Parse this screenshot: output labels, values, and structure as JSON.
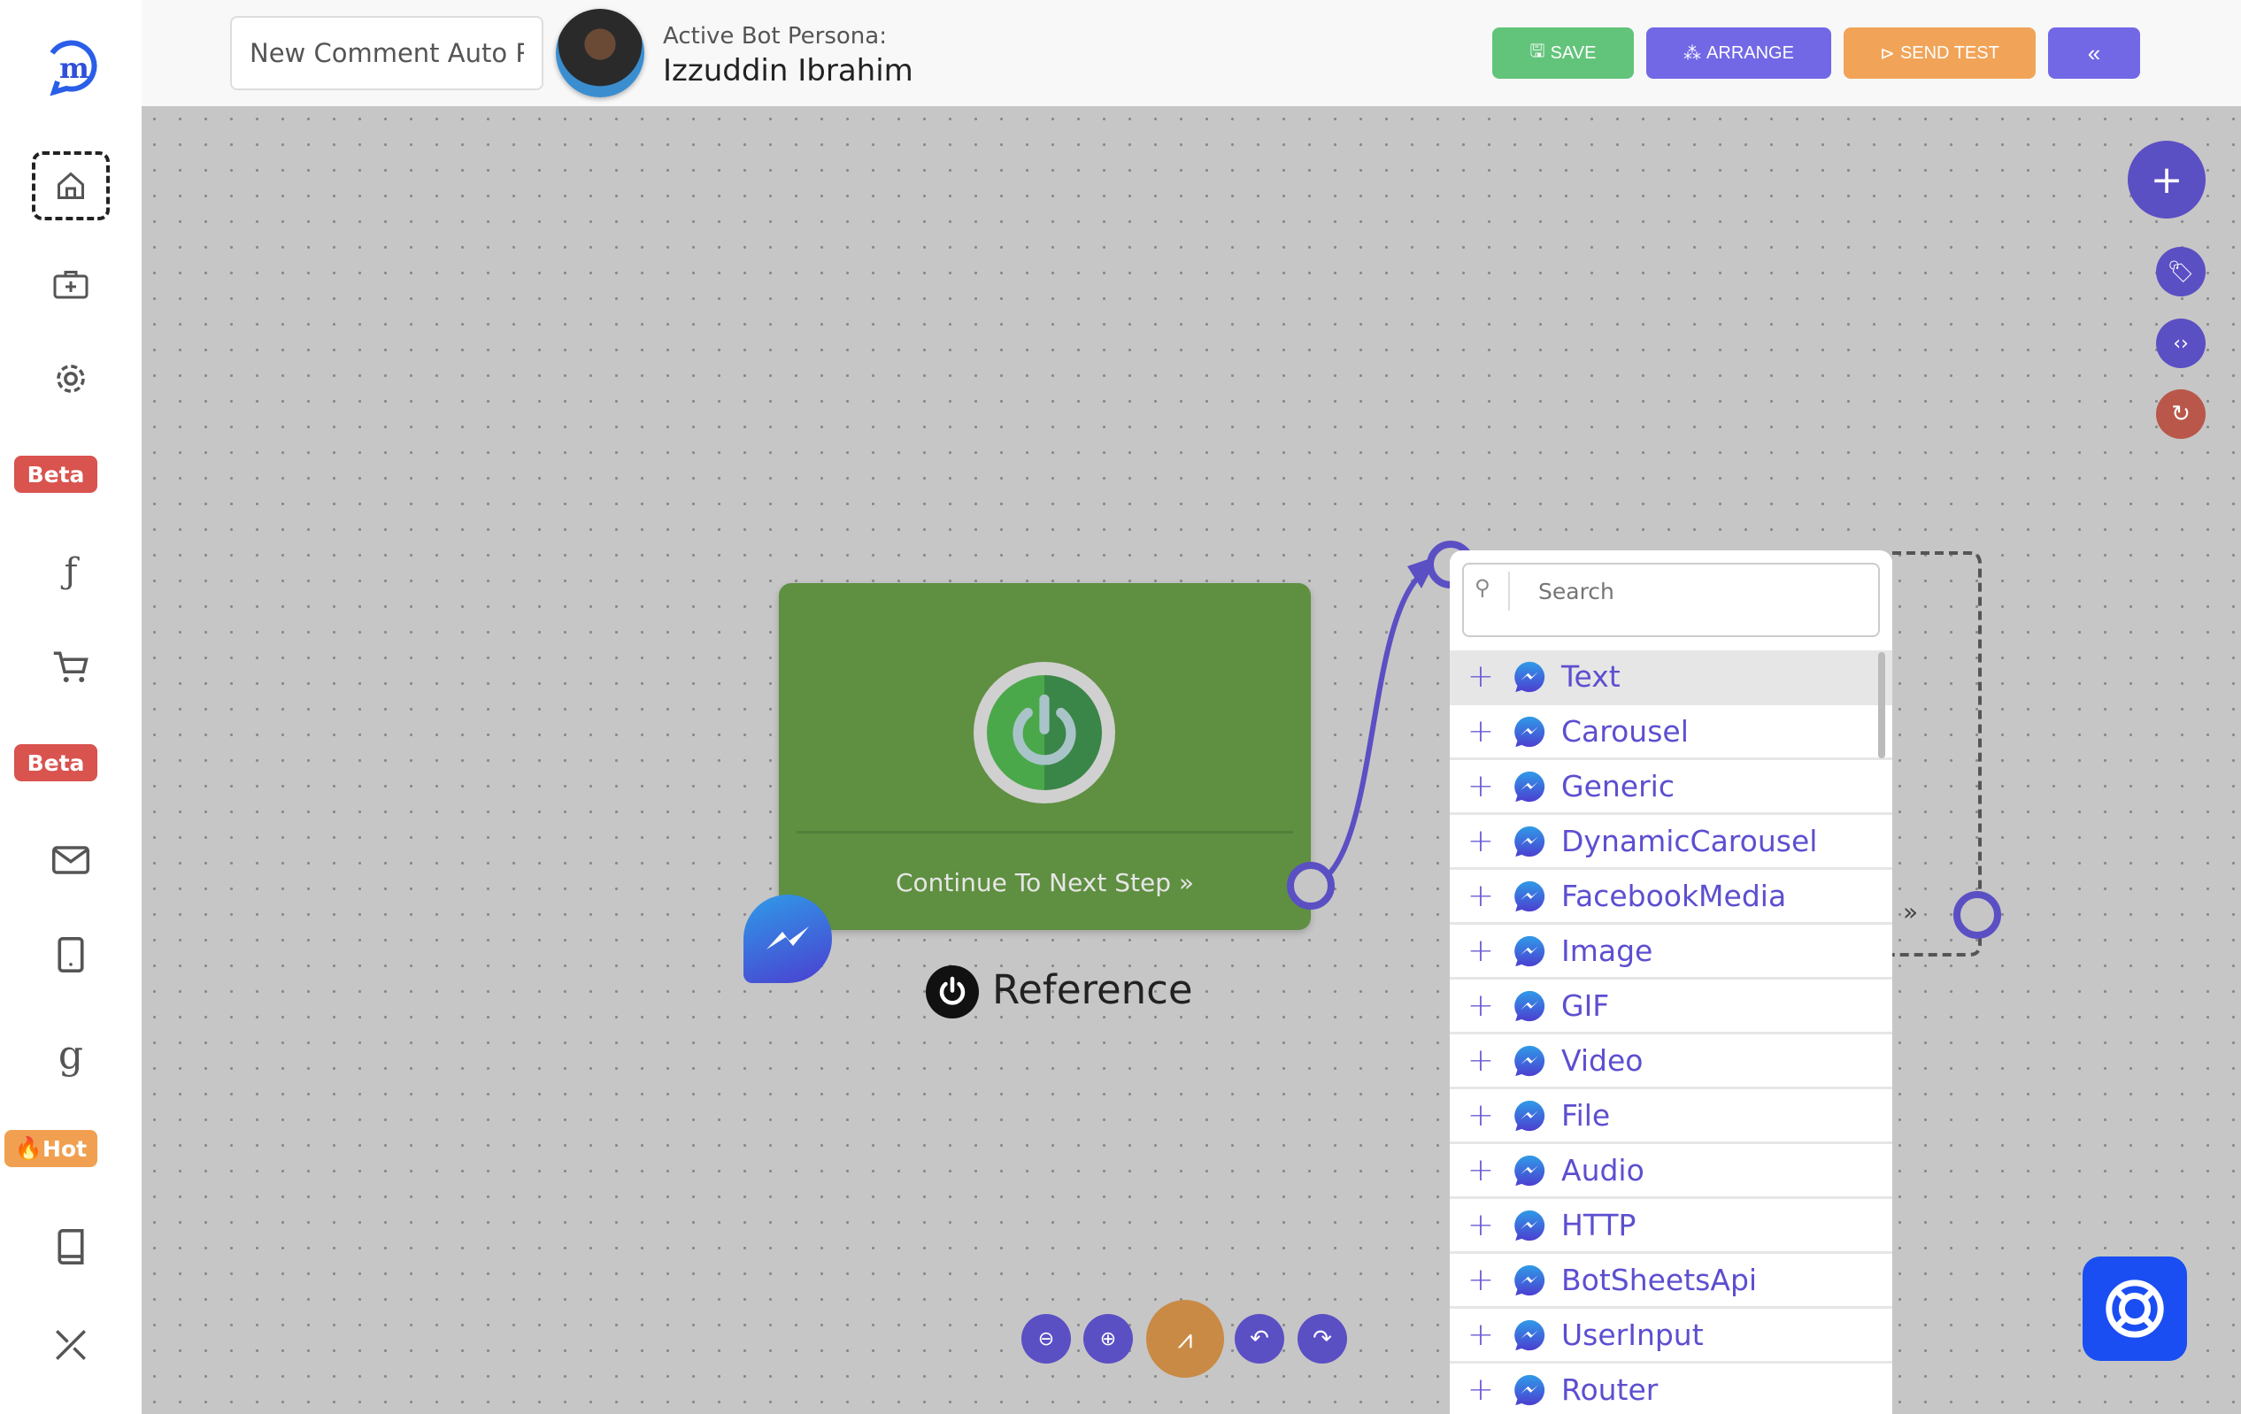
{
  "header": {
    "title_value": "New Comment Auto R",
    "persona_label": "Active Bot Persona:",
    "persona_name": "Izzuddin Ibrahim",
    "buttons": {
      "save": "SAVE",
      "arrange": "ARRANGE",
      "send_test": "SEND TEST",
      "collapse": "«"
    }
  },
  "sidebar": {
    "badges": {
      "beta1": "Beta",
      "beta2": "Beta",
      "hot": "Hot"
    }
  },
  "node": {
    "continue_label": "Continue To Next Step",
    "reference_label": "Reference",
    "color": "#5f8f41"
  },
  "panel": {
    "search_placeholder": "Search",
    "items": [
      "Text",
      "Carousel",
      "Generic",
      "DynamicCarousel",
      "FacebookMedia",
      "Image",
      "GIF",
      "Video",
      "File",
      "Audio",
      "HTTP",
      "BotSheetsApi",
      "UserInput",
      "Router"
    ]
  },
  "colors": {
    "accent": "#5b4fc4",
    "save": "#62c47a",
    "arrange": "#7268e6",
    "send_test": "#f1a458",
    "reset": "#b9574a",
    "help": "#1a4ef2",
    "zoom_fit": "#c98a45"
  }
}
